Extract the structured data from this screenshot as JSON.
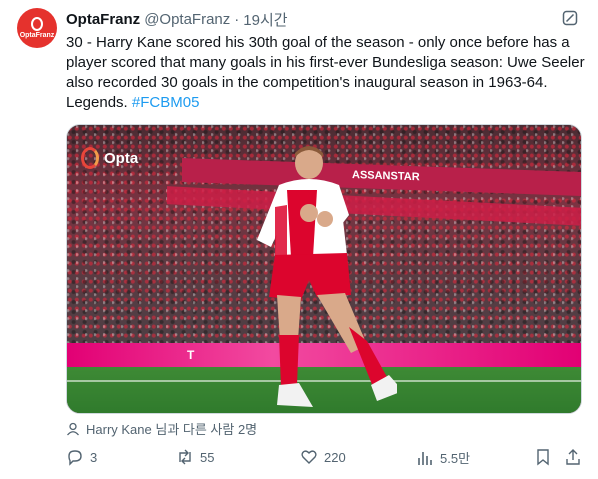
{
  "author": {
    "display_name": "OptaFranz",
    "handle": "@OptaFranz",
    "separator": "·",
    "time": "19시간",
    "avatar_icon": "opta-logo-icon",
    "avatar_brand": "OptaFranz",
    "avatar_color": "#e5322d"
  },
  "tweet": {
    "text": "30 - Harry Kane scored his 30th goal of the season - only once before has a player scored that many goals in his first-ever Bundesliga season: Uwe Seeler also recorded 30 goals in the competition's inaugural season in 1963-64. Legends. ",
    "hashtag": "#FCBM05",
    "link_color": "#1d9bf0"
  },
  "media": {
    "watermark": "Opta",
    "board_text": "T",
    "banner_text": "ASSANSTAR",
    "alt": "photo"
  },
  "tagged": {
    "text": "Harry Kane 님과 다른 사람 2명",
    "icon": "person-icon"
  },
  "actions": {
    "reply": {
      "icon": "reply-icon",
      "count": "3"
    },
    "retweet": {
      "icon": "retweet-icon",
      "count": "55"
    },
    "like": {
      "icon": "heart-icon",
      "count": "220"
    },
    "views": {
      "icon": "views-chart-icon",
      "count": "5.5만"
    },
    "bookmark": {
      "icon": "bookmark-icon"
    },
    "share": {
      "icon": "share-icon"
    }
  }
}
